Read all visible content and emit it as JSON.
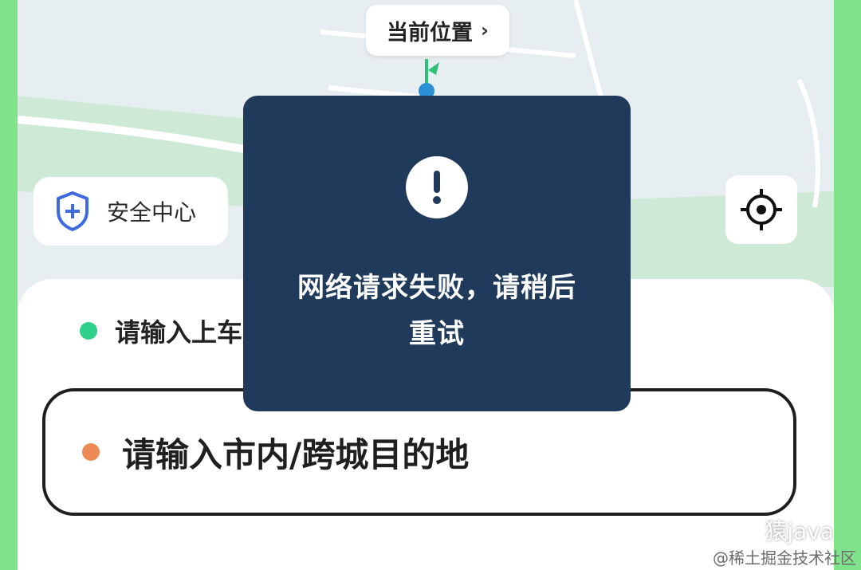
{
  "map": {
    "current_location_label": "当前位置",
    "current_location_chevron": "›"
  },
  "safety_center": {
    "label": "安全中心",
    "icon": "shield-plus-icon"
  },
  "locate_button": {
    "icon": "locate-crosshair-icon"
  },
  "trip_form": {
    "pickup_placeholder": "请输入上车点",
    "pickup_chevron": "›",
    "destination_placeholder": "请输入市内/跨城目的地"
  },
  "toast": {
    "icon": "alert-icon",
    "message": "网络请求失败，请稍后重试"
  },
  "watermark": {
    "channel": "猿java",
    "credit": "@稀土掘金技术社区"
  },
  "colors": {
    "toast_bg": "#1f3a5a",
    "pickup_dot": "#2ed08a",
    "destination_dot": "#ee8a55",
    "map_bg": "#e7eef2",
    "map_green": "#cfe9d7",
    "frame_green": "#7fe38a"
  }
}
